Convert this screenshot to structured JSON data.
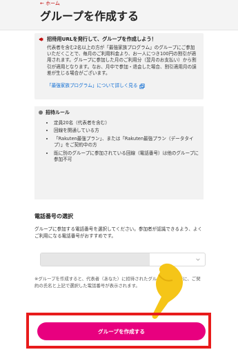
{
  "header": {
    "back_link": "← ホーム",
    "title": "グループを作成する"
  },
  "invite": {
    "heading": "招待用URLを発行して、グループを作成しよう！",
    "body": "代表者を含む2名以上の方が「最強家族プログラム」のグループにご参加いただくことで、毎月のご利用料金より、お一人につき100円の割引が適用されます。グループに参加した月のご利用分（翌月のお支払い）から割引が適用となります。なお、月中で参加・退会した場合、割引適用月の誤差が生じる場合がございます。",
    "link": "「最強家族プログラム」について詳しく見る"
  },
  "rules": {
    "heading": "招待ルール",
    "items": [
      "定員20名（代表者を含む）",
      "回線を開通している方",
      "「Rakuten最強プラン」、または「Rakuten最強プラン（データタイプ）」をご契約中の方",
      "既に別のグループに参加されている回線（電話番号）は他のグループに参加不可"
    ]
  },
  "phone_section": {
    "title": "電話番号の選択",
    "description": "グループに参加する電話番号を選択してください。参加者が認識できるよう、よくご利用になる電話番号がおすすめです。",
    "note": "※グループを作成すると、代表者（あなた）に招待されたグループの参加者に、ご契約の氏名と上記で選択した電話番号が表示されます。"
  },
  "cta": {
    "label": "グループを作成する"
  },
  "colors": {
    "accent": "#e8007f",
    "highlight_frame": "#e81b1b",
    "brand": "#bf0000",
    "link": "#0b6bd3",
    "pointer_hand": "#f5c518"
  }
}
